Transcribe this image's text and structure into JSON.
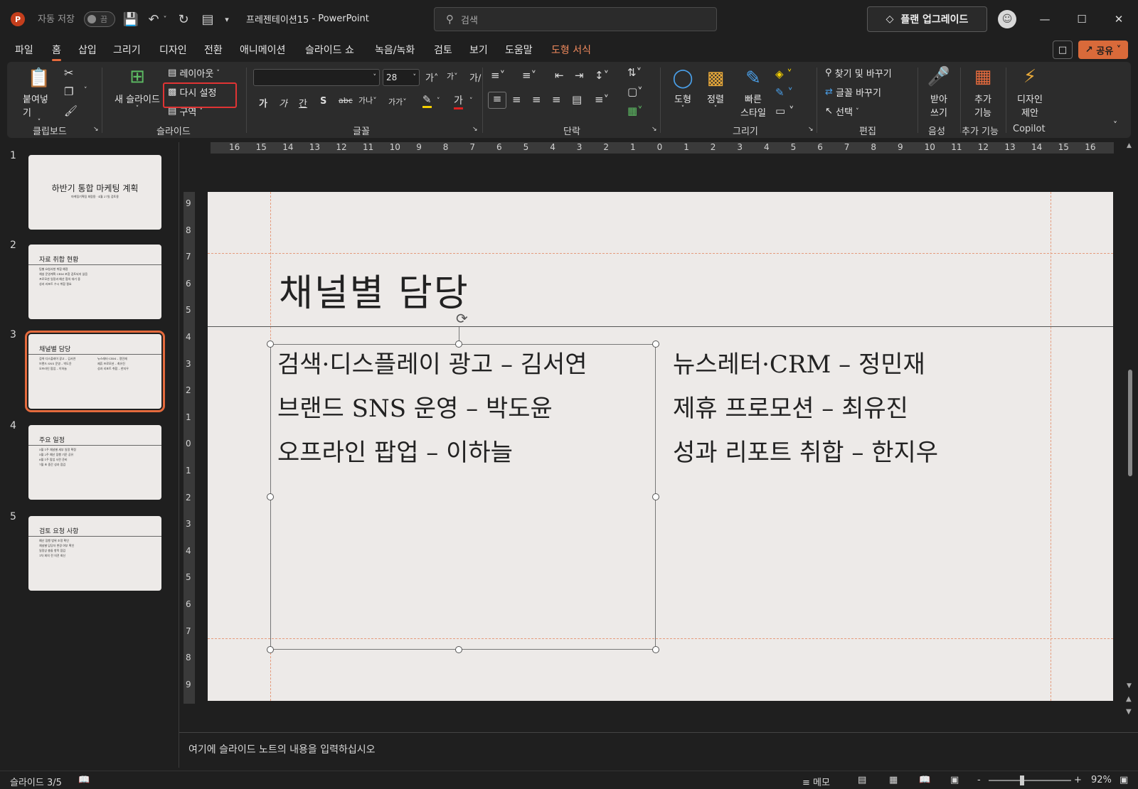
{
  "titlebar": {
    "app_icon": "P",
    "autosave_label": "자동 저장",
    "autosave_state": "끔",
    "doc_name": "프레젠테이션15",
    "separator": "-",
    "app_name": "PowerPoint",
    "search_placeholder": "검색",
    "upgrade_label": "플랜 업그레이드",
    "icons": [
      "save-icon",
      "undo-icon",
      "redo-icon",
      "present-icon",
      "customize-icon"
    ]
  },
  "tabs": [
    "파일",
    "홈",
    "삽입",
    "그리기",
    "디자인",
    "전환",
    "애니메이션",
    "슬라이드 쇼",
    "녹음/녹화",
    "검토",
    "보기",
    "도움말",
    "도형 서식"
  ],
  "active_tab": "홈",
  "share_label": "공유",
  "ribbon": {
    "clipboard": {
      "paste": "붙여넣기",
      "label": "클립보드"
    },
    "slides": {
      "new_slide": "새 슬라이드",
      "layout": "레이아웃",
      "reset": "다시 설정",
      "section": "구역",
      "label": "슬라이드"
    },
    "font": {
      "font_name": "",
      "font_size": "28",
      "bold": "가",
      "italic": "가",
      "underline": "간",
      "strike": "S",
      "label": "글꼴"
    },
    "paragraph": {
      "label": "단락"
    },
    "drawing": {
      "shape": "도형",
      "arrange": "정렬",
      "quick_style_1": "빠른",
      "quick_style_2": "스타일",
      "label": "그리기"
    },
    "editing": {
      "find_replace": "찾기 및 바꾸기",
      "replace_font": "글꼴 바꾸기",
      "select": "선택",
      "label": "편집"
    },
    "voice": {
      "dictate_1": "받아",
      "dictate_2": "쓰기",
      "label": "음성"
    },
    "addins": {
      "addins_1": "추가",
      "addins_2": "기능",
      "label": "추가 기능"
    },
    "copilot": {
      "design_1": "디자인",
      "design_2": "제안",
      "label": "Copilot"
    }
  },
  "thumbnails": [
    {
      "num": "1",
      "title": "하반기 통합 마케팅 계획",
      "sub": "마케팅기획팀 회람용 · 4월 27일 검토용"
    },
    {
      "num": "2",
      "title": "자료 취합 현황",
      "lines": [
        "팀별 요청사항 취합 예정",
        "채널 운영계획 CRM 포함 검토되지 않음",
        "프로모션 일정과 예산 협의 대기 중",
        "성과 리포트 수시 취합 필요"
      ]
    },
    {
      "num": "3",
      "title": "채널별 담당",
      "left": [
        "검색·디스플레이 광고 – 김서연",
        "브랜드 SNS 운영 – 박도윤",
        "오프라인 팝업 – 이하늘"
      ],
      "right": [
        "뉴스레터·CRM – 정민재",
        "제휴 프로모션 – 최유진",
        "성과 리포트 취합 – 한지우"
      ]
    },
    {
      "num": "4",
      "title": "주요 일정",
      "lines": [
        "5월 1주 채널별 세부 일정 확정",
        "5월 2주 예산 집행 기준 공유",
        "6월 1주 팝업 사전 준비",
        "7월 초 중간 성과 점검"
      ]
    },
    {
      "num": "5",
      "title": "검토 요청 사항",
      "lines": [
        "예산 집행 범위 조정 확인",
        "채널별 담당자 변경 여부 확인",
        "일정상 충돌 항목 점검",
        "1차 회의 전 의견 회신"
      ]
    }
  ],
  "ruler_h": [
    "16",
    "15",
    "14",
    "13",
    "12",
    "11",
    "10",
    "9",
    "8",
    "7",
    "6",
    "5",
    "4",
    "3",
    "2",
    "1",
    "0",
    "1",
    "2",
    "3",
    "4",
    "5",
    "6",
    "7",
    "8",
    "9",
    "10",
    "11",
    "12",
    "13",
    "14",
    "15",
    "16"
  ],
  "ruler_v": [
    "9",
    "8",
    "7",
    "6",
    "5",
    "4",
    "3",
    "2",
    "1",
    "0",
    "1",
    "2",
    "3",
    "4",
    "5",
    "6",
    "7",
    "8",
    "9"
  ],
  "slide": {
    "title": "채널별 담당",
    "left": [
      "검색·디스플레이 광고 – 김서연",
      "브랜드 SNS 운영 – 박도윤",
      "오프라인 팝업 – 이하늘"
    ],
    "right": [
      "뉴스레터·CRM – 정민재",
      "제휴 프로모션 – 최유진",
      "성과 리포트 취합 – 한지우"
    ]
  },
  "notes_placeholder": "여기에 슬라이드 노트의 내용을 입력하십시오",
  "status": {
    "slide_count": "슬라이드 3/5",
    "notes_btn": "메모",
    "zoom": "92%",
    "zoom_minus": "-",
    "zoom_plus": "+"
  },
  "colors": {
    "accent": "#e46a3d",
    "highlight": "#e03434",
    "slide_bg": "#edeae8"
  }
}
